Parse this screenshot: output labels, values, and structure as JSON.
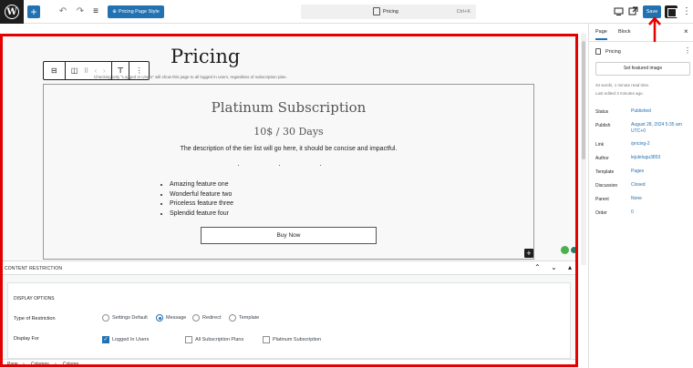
{
  "toolbar": {
    "pattern_style_label": "Pricing Page Style",
    "doc_title": "Pricing",
    "doc_shortcut": "Ctrl+K",
    "save_label": "Save"
  },
  "editor": {
    "page_title": "Pricing",
    "tier": {
      "title": "Platinum Subscription",
      "price": "10$ / 30 Days",
      "description": "The description of the tier list will go here, it should be concise and impactful.",
      "dots": "· · ·",
      "features": [
        "Amazing feature one",
        "Wonderful feature two",
        "Priceless feature three",
        "Splendid feature four"
      ],
      "button_label": "Buy Now"
    }
  },
  "meta_box": {
    "title": "CONTENT RESTRICTION",
    "display_options_heading": "DISPLAY OPTIONS",
    "type_label": "Type of Restriction",
    "type_options": [
      "Settings Default",
      "Message",
      "Redirect",
      "Template"
    ],
    "selected_type": "Message",
    "display_for_label": "Display For",
    "display_for_options": [
      "Logged In Users",
      "All Subscription Plans",
      "Platinum Subscription"
    ],
    "checked_display_for": "Logged In Users",
    "help_text": "Checking only \"Logged In Users\" will show this page to all logged in users, regardless of subscription plan."
  },
  "breadcrumbs": [
    "Page",
    "Columns",
    "Column"
  ],
  "sidebar": {
    "tabs": [
      "Page",
      "Block"
    ],
    "active_tab": "Page",
    "page_name": "Pricing",
    "featured_image_label": "Set featured image",
    "stats_line1": "34 words, 1 minute read time.",
    "stats_line2": "Last edited 3 minutes ago.",
    "rows": [
      {
        "label": "Status",
        "value": "Published"
      },
      {
        "label": "Publish",
        "value": "August 28, 2024 5:35 am UTC+0"
      },
      {
        "label": "Link",
        "value": "/pricing-2"
      },
      {
        "label": "Author",
        "value": "lejulelugu3853"
      },
      {
        "label": "Template",
        "value": "Pages"
      },
      {
        "label": "Discussion",
        "value": "Closed"
      },
      {
        "label": "Parent",
        "value": "None"
      },
      {
        "label": "Order",
        "value": "0"
      }
    ]
  },
  "colors": {
    "accent": "#2271b1",
    "annotation": "#e30000",
    "dark": "#1e1e1e"
  }
}
